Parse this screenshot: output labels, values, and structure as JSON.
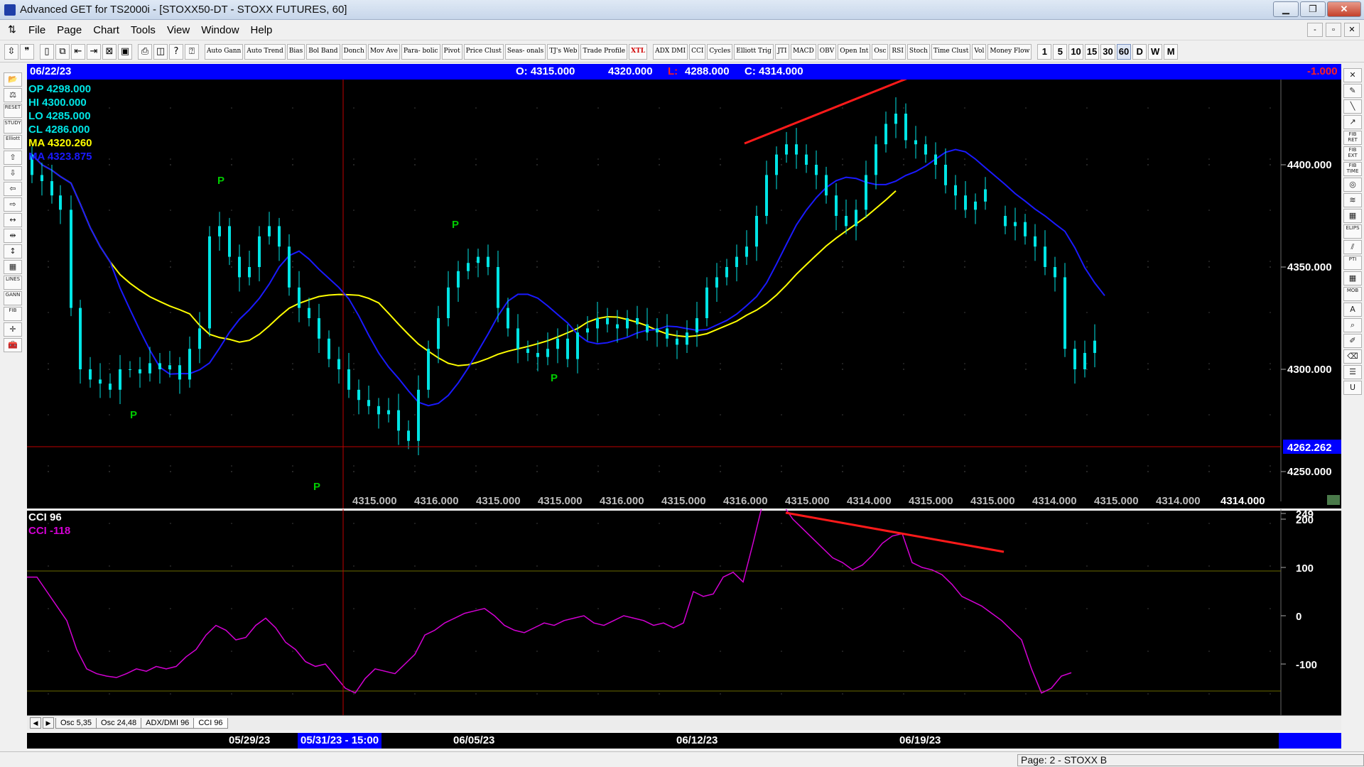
{
  "window": {
    "title": "Advanced GET for TS2000i - [STOXX50-DT - STOXX FUTURES, 60]",
    "buttons": {
      "minimize": "▁",
      "maximize": "❐",
      "close": "✕"
    }
  },
  "menu": {
    "items": [
      "File",
      "Page",
      "Chart",
      "Tools",
      "View",
      "Window",
      "Help"
    ],
    "mdi_buttons": [
      "-",
      "▫",
      "✕"
    ]
  },
  "toolbar": {
    "icons": [
      "pointer-icon",
      "quote-icon",
      "new-page-icon",
      "copy-page-icon",
      "page-back-icon",
      "page-forward-icon",
      "cross-page-icon",
      "close-page-icon",
      "print-icon",
      "preview-icon",
      "help-icon",
      "context-help-icon"
    ],
    "studies": [
      "Auto Gann",
      "Auto Trend",
      "Bias",
      "Bol Band",
      "Donch",
      "Mov Ave",
      "Para- bolic",
      "Pivot",
      "Price Clust",
      "Seas- onals",
      "TJ's Web",
      "Trade Profile",
      "XTL",
      "ADX DMI",
      "CCI",
      "Cycles",
      "Elliott Trig",
      "JTI",
      "MACD",
      "OBV",
      "Open Int",
      "Osc",
      "RSI",
      "Stoch",
      "Time Clust",
      "Vol",
      "Money Flow"
    ],
    "periods": [
      "1",
      "5",
      "10",
      "15",
      "30",
      "60",
      "D",
      "W",
      "M"
    ],
    "active_period": "60"
  },
  "infobar": {
    "date": "06/22/23",
    "open": "O: 4315.000",
    "high": "4320.000",
    "low_label": "L:",
    "low": "4288.000",
    "close": "C: 4314.000",
    "change": "-1.000"
  },
  "overlay": {
    "op": "OP  4298.000",
    "hi": "HI    4300.000",
    "lo": "LO   4285.000",
    "cl": "CL   4286.000",
    "ma1": "MA  4320.260",
    "ma2": "MA  4323.875"
  },
  "colors": {
    "candle": "#00e5e5",
    "ma_yellow": "#ffff00",
    "ma_blue": "#1a1aff",
    "trend_red": "#ff1a1a",
    "pivot": "#00cc00",
    "cci": "#d400d4",
    "crosshair": "#c00000"
  },
  "main_axis": {
    "ticks": [
      "4400.000",
      "4350.000",
      "4300.000",
      "4250.000"
    ],
    "crosshair_label": "4262.262"
  },
  "bottom_values": [
    "4315.000",
    "4316.000",
    "4315.000",
    "4315.000",
    "4316.000",
    "4315.000",
    "4316.000",
    "4315.000",
    "4314.000",
    "4315.000",
    "4315.000",
    "4314.000",
    "4315.000",
    "4314.000",
    "4314.000"
  ],
  "pivot_label": "P",
  "cci": {
    "title": "CCI 96",
    "value": "CCI  -118",
    "ticks": [
      "249",
      "200",
      "100",
      "0",
      "-100"
    ]
  },
  "tabs": [
    "Osc 5,35",
    "Osc 24,48",
    "ADX/DMI 96",
    "CCI 96"
  ],
  "active_tab": "CCI 96",
  "tab_nav": [
    "◀",
    "▶"
  ],
  "dates": [
    "05/29/23",
    "05/31/23 - 15:00",
    "06/05/23",
    "06/12/23",
    "06/19/23"
  ],
  "status": "Page: 2 - STOXX B",
  "left_tools": [
    "folder-icon",
    "balance-icon",
    "reset-icon",
    "study-icon",
    "elliott-icon",
    "arrow-up-icon",
    "arrow-down-icon",
    "arrow-left-icon",
    "arrow-right-icon",
    "expand-h-icon",
    "compress-h-icon",
    "expand-v-icon",
    "grid-icon",
    "lines-icon",
    "gann-icon",
    "fib-icon",
    "crosshair-icon",
    "toolbox-icon"
  ],
  "right_tools": [
    "close-tool-icon",
    "pen-icon",
    "line-icon",
    "ray-icon",
    "fib-ret-icon",
    "fib-ext-icon",
    "fib-time-icon",
    "circle-icon",
    "fan-icon",
    "box-icon",
    "ellipse-icon",
    "channel-icon",
    "pti-icon",
    "grid-tool-icon",
    "mob-icon",
    "text-icon",
    "zoom-icon",
    "marker-icon",
    "erase-icon",
    "object-list-icon",
    "undo-icon"
  ],
  "right_tool_labels": [
    "✕",
    "✎",
    "╲",
    "↗",
    "FIB RET",
    "FIB EXT",
    "FIB TIME",
    "◎",
    "≋",
    "▦",
    "ELIPS",
    "⫽",
    "PTI",
    "▦",
    "MOB",
    "A",
    "⌕",
    "✐",
    "⌫",
    "☰",
    "U"
  ],
  "left_tool_labels": [
    "📂",
    "⚖",
    "RESET",
    "STUDY",
    "Elliott",
    "⇧",
    "⇩",
    "⇦",
    "⇨",
    "↔",
    "⇹",
    "↕",
    "▦",
    "LINES",
    "GANN",
    "FIB",
    "✛",
    "🧰"
  ]
}
